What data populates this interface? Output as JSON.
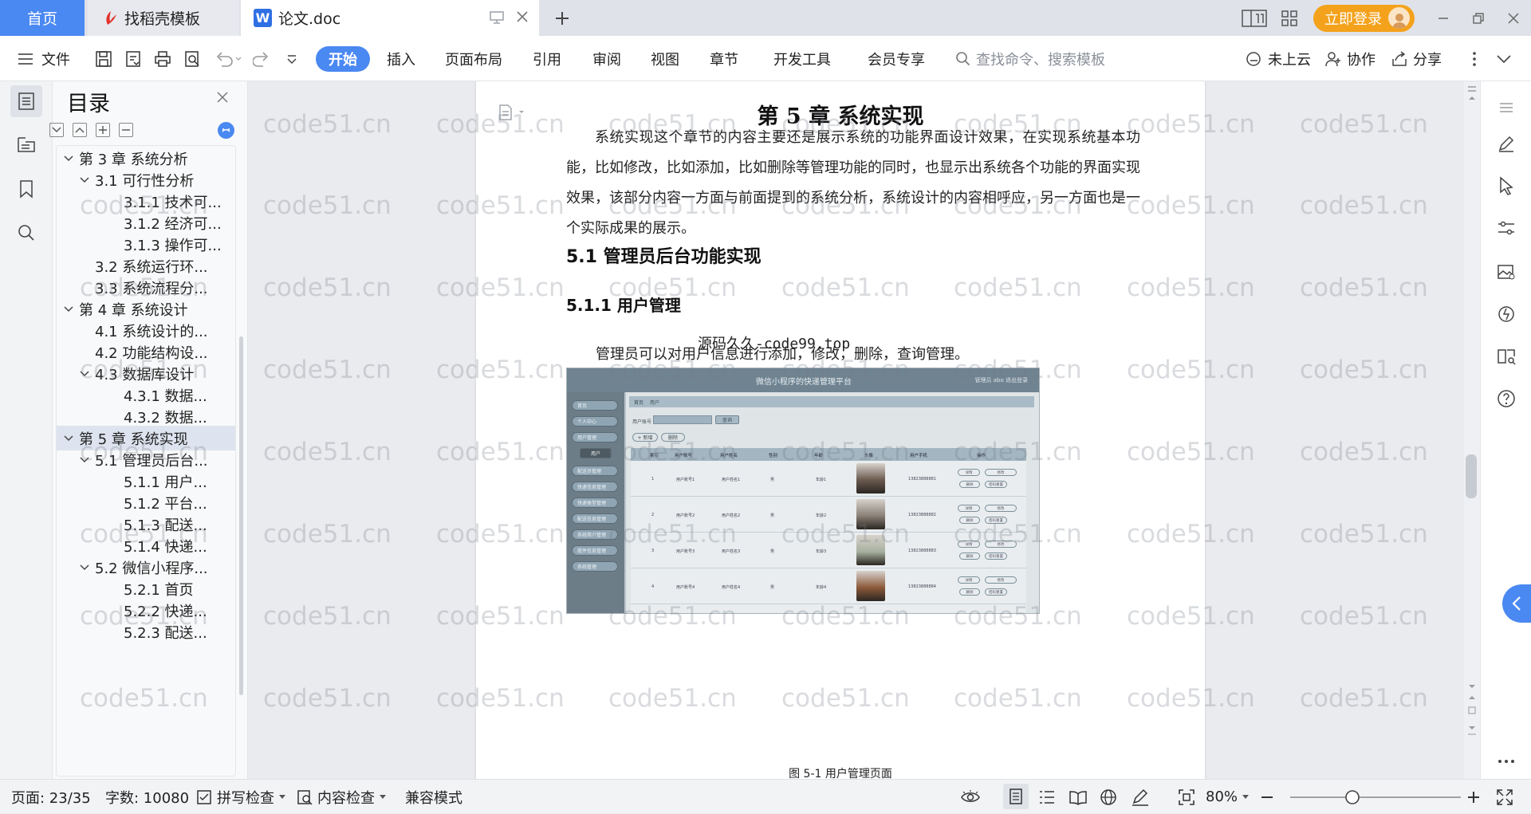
{
  "tabs": {
    "home": "首页",
    "templates": "找稻壳模板",
    "document": "论文.doc"
  },
  "titlebar": {
    "login": "立即登录"
  },
  "menu": {
    "file": "文件",
    "start": "开始",
    "insert": "插入",
    "layout": "页面布局",
    "reference": "引用",
    "review": "审阅",
    "view": "视图",
    "section": "章节",
    "devtools": "开发工具",
    "member": "会员专享",
    "search_placeholder": "查找命令、搜索模板",
    "cloud": "未上云",
    "collab": "协作",
    "share": "分享"
  },
  "toc": {
    "title": "目录",
    "items": [
      {
        "label": "第 3 章  系统分析",
        "level": 1,
        "expanded": true
      },
      {
        "label": "3.1 可行性分析",
        "level": 2,
        "expanded": true
      },
      {
        "label": "3.1.1 技术可...",
        "level": 3
      },
      {
        "label": "3.1.2 经济可...",
        "level": 3
      },
      {
        "label": "3.1.3 操作可...",
        "level": 3
      },
      {
        "label": "3.2 系统运行环...",
        "level": 2
      },
      {
        "label": "3.3 系统流程分...",
        "level": 2
      },
      {
        "label": "第 4 章  系统设计",
        "level": 1,
        "expanded": true
      },
      {
        "label": "4.1  系统设计的...",
        "level": 2
      },
      {
        "label": "4.2  功能结构设...",
        "level": 2
      },
      {
        "label": "4.3  数据库设计",
        "level": 2,
        "expanded": true
      },
      {
        "label": "4.3.1  数据...",
        "level": 3
      },
      {
        "label": "4.3.2  数据...",
        "level": 3
      },
      {
        "label": "第 5 章  系统实现",
        "level": 1,
        "expanded": true,
        "active": true
      },
      {
        "label": "5.1 管理员后台...",
        "level": 2,
        "expanded": true
      },
      {
        "label": "5.1.1  用户...",
        "level": 3
      },
      {
        "label": "5.1.2  平台...",
        "level": 3
      },
      {
        "label": "5.1.3  配送...",
        "level": 3
      },
      {
        "label": "5.1.4  快递...",
        "level": 3
      },
      {
        "label": "5.2  微信小程序...",
        "level": 2,
        "expanded": true
      },
      {
        "label": "5.2.1  首页",
        "level": 3
      },
      {
        "label": "5.2.2  快递...",
        "level": 3
      },
      {
        "label": "5.2.3  配送...",
        "level": 3
      }
    ]
  },
  "document": {
    "chapter_title": "第 5 章  系统实现",
    "intro_paragraph": "系统实现这个章节的内容主要还是展示系统的功能界面设计效果，在实现系统基本功能，比如修改，比如添加，比如删除等管理功能的同时，也显示出系统各个功能的界面实现效果，该部分内容一方面与前面提到的系统分析，系统设计的内容相呼应，另一方面也是一个实际成果的展示。",
    "section_heading": "5.1 管理员后台功能实现",
    "subsection_heading": "5.1.1  用户管理",
    "overlay_text": "源码久久-code99.top",
    "paragraph2": "管理员可以对用户信息进行添加，修改，删除，查询管理。",
    "caption": "图 5-1  用户管理页面"
  },
  "embedded_screenshot": {
    "header_title": "微信小程序的快递管理平台",
    "header_right": "管理员 abo    退出登录",
    "sidebar_buttons": [
      "首页",
      "个人中心",
      "用户管理",
      "用户",
      "配送员管理",
      "快递信息管理",
      "快递类型管理",
      "配送信息管理",
      "系统简介管理",
      "揽件信息管理",
      "系统管理"
    ],
    "breadcrumb": [
      "首页",
      "用户"
    ],
    "search_label": "用户账号",
    "search_button": "查询",
    "add_button": "+ 新增",
    "delete_button": "删除",
    "columns": [
      "索引",
      "用户账号",
      "用户姓名",
      "性别",
      "年龄",
      "头像",
      "用户手机",
      "操作"
    ],
    "rows": [
      {
        "index": "1",
        "account": "用户账号1",
        "name": "用户姓名1",
        "gender": "男",
        "age": "年龄1",
        "phone": "13823888881",
        "photo_color": "#6b5a4f"
      },
      {
        "index": "2",
        "account": "用户账号2",
        "name": "用户姓名2",
        "gender": "男",
        "age": "年龄2",
        "phone": "13823888882",
        "photo_color": "#8a8076"
      },
      {
        "index": "3",
        "account": "用户账号3",
        "name": "用户姓名3",
        "gender": "男",
        "age": "年龄3",
        "phone": "13823888883",
        "photo_color": "#a7b19f"
      },
      {
        "index": "4",
        "account": "用户账号4",
        "name": "用户姓名4",
        "gender": "男",
        "age": "年龄4",
        "phone": "13823888884",
        "photo_color": "#8d5a3a"
      }
    ],
    "op_labels": [
      "详情",
      "修改",
      "删除",
      "密码重置"
    ]
  },
  "status": {
    "page": "页面: 23/35",
    "words": "字数: 10080",
    "spellcheck": "拼写检查",
    "content_check": "内容检查",
    "compat": "兼容模式",
    "zoom": "80%"
  },
  "watermark": "code51.cn",
  "colors": {
    "accent": "#4a88f2",
    "login": "#f4a21c"
  }
}
